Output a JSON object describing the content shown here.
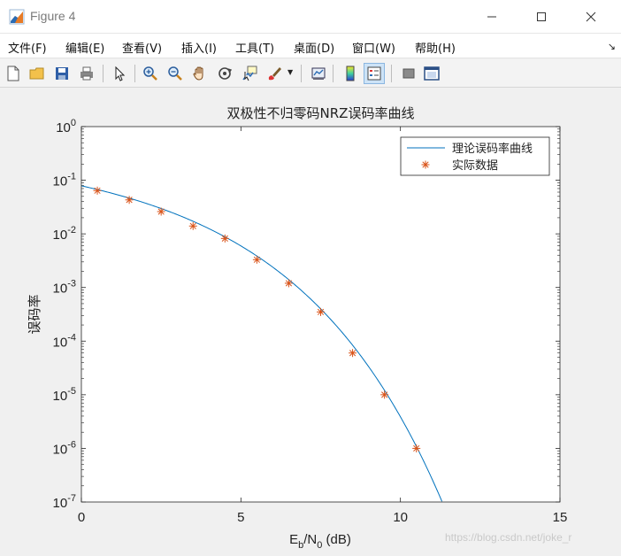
{
  "window": {
    "title": "Figure 4"
  },
  "menu": [
    {
      "label": "文件(F)",
      "name": "menu-file"
    },
    {
      "label": "编辑(E)",
      "name": "menu-edit"
    },
    {
      "label": "查看(V)",
      "name": "menu-view"
    },
    {
      "label": "插入(I)",
      "name": "menu-insert"
    },
    {
      "label": "工具(T)",
      "name": "menu-tools"
    },
    {
      "label": "桌面(D)",
      "name": "menu-desktop"
    },
    {
      "label": "窗口(W)",
      "name": "menu-window"
    },
    {
      "label": "帮助(H)",
      "name": "menu-help"
    }
  ],
  "toolbar": [
    {
      "icon": "new-figure-icon"
    },
    {
      "icon": "open-folder-icon"
    },
    {
      "icon": "save-icon"
    },
    {
      "icon": "print-icon"
    },
    {
      "icon": "pointer-icon"
    },
    {
      "icon": "zoom-in-icon"
    },
    {
      "icon": "zoom-out-icon"
    },
    {
      "icon": "pan-hand-icon"
    },
    {
      "icon": "rotate-3d-icon"
    },
    {
      "icon": "data-cursor-icon"
    },
    {
      "icon": "brush-icon"
    },
    {
      "icon": "link-plot-icon"
    },
    {
      "icon": "colorbar-icon"
    },
    {
      "icon": "legend-icon"
    },
    {
      "icon": "hide-plot-tools-icon"
    },
    {
      "icon": "show-plot-tools-icon"
    }
  ],
  "chart_data": {
    "type": "line",
    "title": "双极性不归零码NRZ误码率曲线",
    "xlabel_main": "E",
    "xlabel_sub1": "b",
    "xlabel_mid": "/N",
    "xlabel_sub2": "0",
    "xlabel_tail": " (dB)",
    "ylabel": "误码率",
    "xlim": [
      0,
      15
    ],
    "ylim": [
      1e-07,
      1
    ],
    "yscale": "log",
    "x_ticks": [
      "0",
      "5",
      "10",
      "15"
    ],
    "y_ticks": [
      "-7",
      "-6",
      "-5",
      "-4",
      "-3",
      "-2",
      "-1",
      "0"
    ],
    "y_tick_base": "10",
    "legend_position": "top-right",
    "series": [
      {
        "name": "理论误码率曲线",
        "kind": "line",
        "color": "#0072bd",
        "formula": "0.5*erfc(sqrt(10^(x/10)))",
        "x_range": [
          0,
          11.3
        ]
      },
      {
        "name": "实际数据",
        "kind": "marker",
        "marker": "asterisk",
        "color": "#d95319",
        "x": [
          0.5,
          1.5,
          2.5,
          3.5,
          4.5,
          5.5,
          6.5,
          7.5,
          8.5,
          9.5,
          10.5
        ],
        "y": [
          0.064,
          0.043,
          0.026,
          0.014,
          0.0082,
          0.0033,
          0.0012,
          0.00035,
          6e-05,
          1e-05,
          1e-06
        ]
      }
    ]
  },
  "watermark": "https://blog.csdn.net/joke_r"
}
